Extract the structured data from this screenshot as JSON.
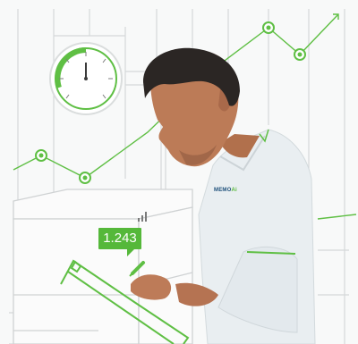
{
  "reading": {
    "value": "1.243"
  },
  "brand": {
    "logo_text": "MEMO",
    "logo_accent": "Ai"
  },
  "colors": {
    "accent": "#55b83a",
    "line": "#cfd3d4",
    "shirt": "#e7edf1",
    "skin": "#b97a57",
    "hair": "#2a2523"
  },
  "icons": {
    "gauge": "gauge-icon",
    "signal": "signal-bars-icon",
    "pen": "pen-icon"
  }
}
